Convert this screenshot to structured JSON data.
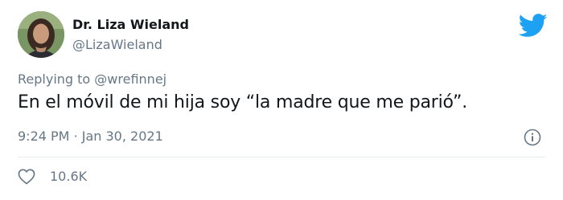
{
  "author": {
    "name": "Dr. Liza Wieland",
    "handle": "@LizaWieland"
  },
  "reply": {
    "prefix": "Replying to",
    "to": "@wrefinnej"
  },
  "tweet": {
    "text": "En el móvil de mi hija soy “la madre que me parió”.",
    "time": "9:24 PM",
    "separator": "·",
    "date": "Jan 30, 2021"
  },
  "stats": {
    "likes": "10.6K"
  },
  "icons": {
    "brand": "twitter-bird-icon",
    "info": "info-icon",
    "like": "heart-icon"
  },
  "colors": {
    "twitter_blue": "#1da1f2",
    "secondary_text": "#657786",
    "primary_text": "#14171a",
    "divider": "#e6ecf0"
  }
}
